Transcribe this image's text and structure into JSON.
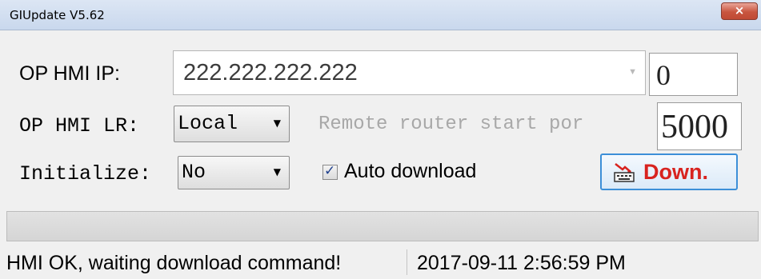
{
  "window": {
    "title": "GIUpdate V5.62",
    "close_label": "×"
  },
  "ip_row": {
    "label": "OP HMI IP:",
    "value": "222.222.222.222",
    "dropdown_arrow": "▼",
    "side_value": "0"
  },
  "lr_row": {
    "label": "OP HMI LR:",
    "selected": "Local",
    "dropdown_arrow": "▼",
    "remote_label": "Remote router start por",
    "port_value": "5000"
  },
  "init_row": {
    "label": "Initialize:",
    "selected": "No",
    "dropdown_arrow": "▼"
  },
  "auto_download": {
    "label": "Auto download",
    "checked": true,
    "check_mark": "✓"
  },
  "download_button": {
    "label": "Down.",
    "icon": "download-icon"
  },
  "progress": {
    "value_percent": 0,
    "fill_color": "#37a83a"
  },
  "status": {
    "message": "HMI OK, waiting download command!",
    "datetime": "2017-09-11  2:56:59 PM"
  },
  "colors": {
    "download_text": "#d8231f",
    "button_border": "#3c8fd8",
    "disabled_text": "#a8a8a8"
  }
}
